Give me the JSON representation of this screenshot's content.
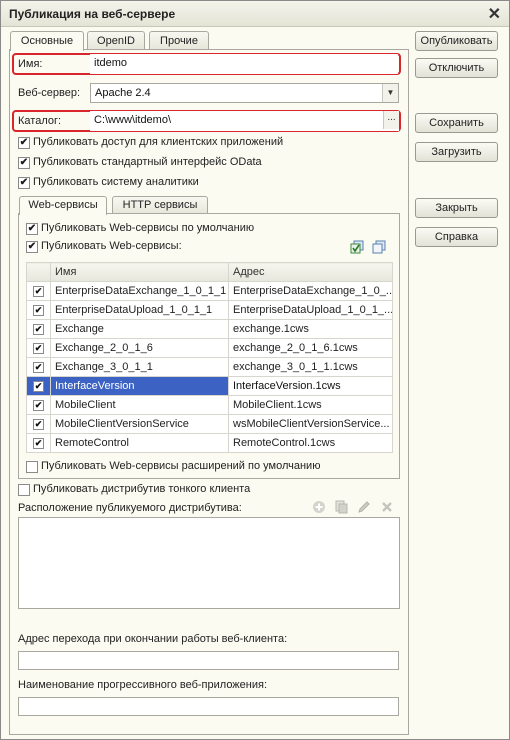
{
  "window": {
    "title": "Публикация на веб-сервере",
    "close_glyph": "✕"
  },
  "tabs": [
    "Основные",
    "OpenID",
    "Прочие"
  ],
  "form": {
    "name_label": "Имя:",
    "name_value": "itdemo",
    "webserver_label": "Веб-сервер:",
    "webserver_value": "Apache 2.4",
    "catalog_label": "Каталог:",
    "catalog_value": "C:\\www\\itdemo\\",
    "dots": "...",
    "checkboxes": [
      "Публиковать доступ для клиентских приложений",
      "Публиковать стандартный интерфейс OData",
      "Публиковать систему аналитики"
    ]
  },
  "subtabs": [
    "Web-сервисы",
    "HTTP сервисы"
  ],
  "ws": {
    "default_label": "Публиковать Web-сервисы по умолчанию",
    "publish_label": "Публиковать Web-сервисы:",
    "columns": [
      "Имя",
      "Адрес"
    ],
    "rows": [
      {
        "name": "EnterpriseDataExchange_1_0_1_1",
        "addr": "EnterpriseDataExchange_1_0_..."
      },
      {
        "name": "EnterpriseDataUpload_1_0_1_1",
        "addr": "EnterpriseDataUpload_1_0_1_..."
      },
      {
        "name": "Exchange",
        "addr": "exchange.1cws"
      },
      {
        "name": "Exchange_2_0_1_6",
        "addr": "exchange_2_0_1_6.1cws"
      },
      {
        "name": "Exchange_3_0_1_1",
        "addr": "exchange_3_0_1_1.1cws"
      },
      {
        "name": "InterfaceVersion",
        "addr": "InterfaceVersion.1cws"
      },
      {
        "name": "MobileClient",
        "addr": "MobileClient.1cws"
      },
      {
        "name": "MobileClientVersionService",
        "addr": "wsMobileClientVersionService..."
      },
      {
        "name": "RemoteControl",
        "addr": "RemoteControl.1cws"
      }
    ],
    "ext_label": "Публиковать Web-сервисы расширений по умолчанию"
  },
  "thin": {
    "publish_label": "Публиковать дистрибутив тонкого клиента",
    "location_label": "Расположение публикуемого дистрибутива:"
  },
  "exit_url_label": "Адрес перехода при окончании работы веб-клиента:",
  "pwa_label": "Наименование прогрессивного веб-приложения:",
  "buttons": {
    "publish": "Опубликовать",
    "disable": "Отключить",
    "save": "Сохранить",
    "load": "Загрузить",
    "close": "Закрыть",
    "help": "Справка"
  },
  "colors": {
    "highlight": "#d9252b",
    "selection": "#3c63c4"
  }
}
